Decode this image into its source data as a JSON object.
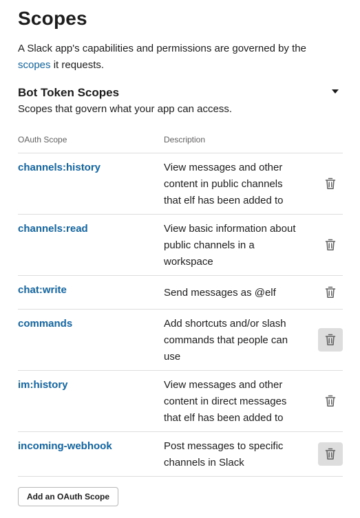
{
  "page": {
    "title": "Scopes",
    "intro_before_link": "A Slack app's capabilities and permissions are governed by the ",
    "intro_link": "scopes",
    "intro_after_link": " it requests."
  },
  "bot_section": {
    "title": "Bot Token Scopes",
    "subtitle": "Scopes that govern what your app can access.",
    "toggle_icon": "caret-down-icon"
  },
  "table": {
    "col_scope": "OAuth Scope",
    "col_description": "Description",
    "rows": [
      {
        "scope": "channels:history",
        "description": "View messages and other content in public channels that elf has been added to"
      },
      {
        "scope": "channels:read",
        "description": "View basic information about public channels in a workspace"
      },
      {
        "scope": "chat:write",
        "description": "Send messages as @elf"
      },
      {
        "scope": "commands",
        "description": "Add shortcuts and/or slash commands that people can use"
      },
      {
        "scope": "im:history",
        "description": "View messages and other content in direct messages that elf has been added to"
      },
      {
        "scope": "incoming-webhook",
        "description": "Post messages to specific channels in Slack"
      }
    ],
    "delete_icon": "trash-icon"
  },
  "add_button": {
    "label": "Add an OAuth Scope"
  },
  "colors": {
    "link": "#1264a3",
    "text": "#1d1c1d",
    "muted": "#616061",
    "divider": "#dddddd",
    "hover_bg": "#dddddd"
  }
}
